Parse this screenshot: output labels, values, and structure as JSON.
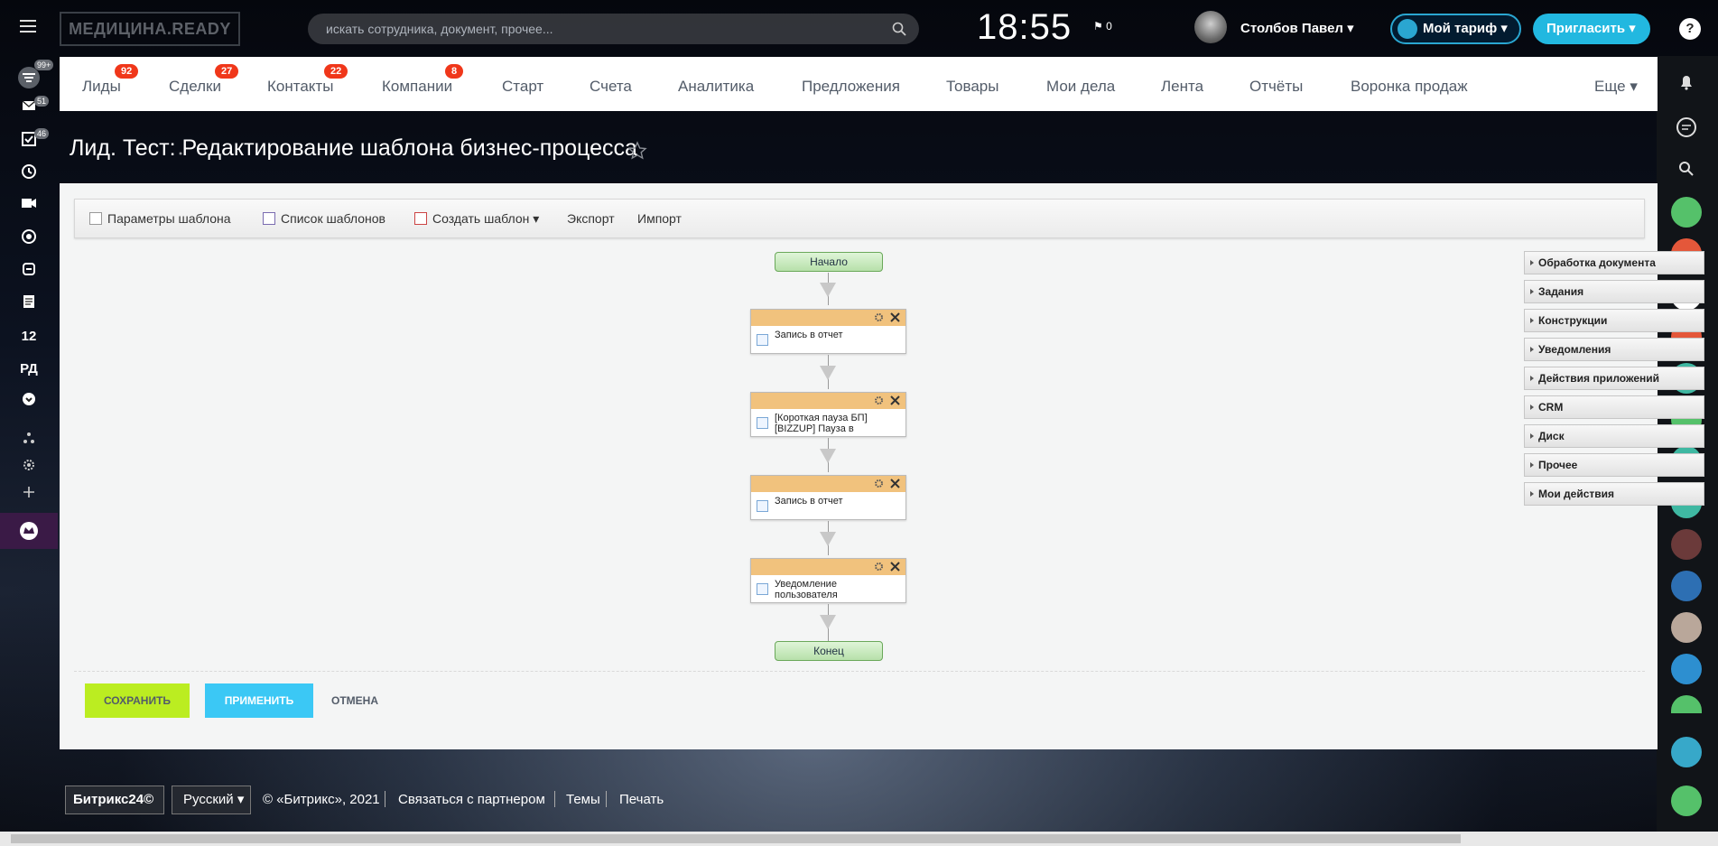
{
  "header": {
    "logo": "МЕДИЦИНА.READY",
    "search_placeholder": "искать сотрудника, документ, прочее...",
    "clock": "18:55",
    "flag_count": "0",
    "user_name": "Столбов Павел ▾",
    "plan_label": "Мой тариф ▾",
    "invite_label": "Пригласить ▾",
    "help": "?"
  },
  "left_sidebar": {
    "badges": {
      "filter": "99+",
      "mail": "51",
      "tasks": "46"
    },
    "text_items": {
      "num": "12",
      "rd": "РД"
    }
  },
  "nav": {
    "items": [
      {
        "label": "Лиды",
        "badge": "92"
      },
      {
        "label": "Сделки",
        "badge": "27"
      },
      {
        "label": "Контакты",
        "badge": "22"
      },
      {
        "label": "Компании",
        "badge": "8"
      },
      {
        "label": "Старт"
      },
      {
        "label": "Счета"
      },
      {
        "label": "Аналитика"
      },
      {
        "label": "Предложения"
      },
      {
        "label": "Товары"
      },
      {
        "label": "Мои дела"
      },
      {
        "label": "Лента"
      },
      {
        "label": "Отчёты"
      },
      {
        "label": "Воронка продаж"
      },
      {
        "label": "Еще ▾"
      }
    ]
  },
  "page": {
    "title": "Лид. Тест: Редактирование шаблона бизнес-процесса"
  },
  "toolbar": {
    "params": "Параметры шаблона",
    "list": "Список шаблонов",
    "create": "Создать шаблон ▾",
    "export": "Экспорт",
    "import": "Импорт"
  },
  "workflow": {
    "start": "Начало",
    "end": "Конец",
    "activities": [
      {
        "label": "Запись в отчет"
      },
      {
        "label": "[Короткая пауза БП] [BIZZUP] Пауза в"
      },
      {
        "label": "Запись в отчет"
      },
      {
        "label": "Уведомление пользователя"
      }
    ]
  },
  "groups": [
    "Обработка документа",
    "Задания",
    "Конструкции",
    "Уведомления",
    "Действия приложений",
    "CRM",
    "Диск",
    "Прочее",
    "Мои действия"
  ],
  "actions": {
    "save": "СОХРАНИТЬ",
    "apply": "ПРИМЕНИТЬ",
    "cancel": "ОТМЕНА"
  },
  "footer": {
    "logo": "Битрикс24©",
    "lang": "Русский ▾",
    "copyright": "© «Битрикс», 2021",
    "partner": "Связаться с партнером",
    "themes": "Темы",
    "print": "Печать"
  },
  "colors": {
    "save": "#bbed21",
    "apply": "#3bc8f5",
    "badge": "#f0371a",
    "activity_header": "#f1c27d"
  }
}
